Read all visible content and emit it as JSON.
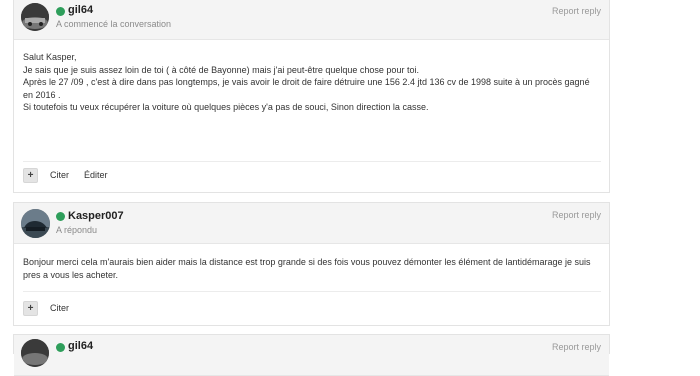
{
  "posts": [
    {
      "username": "gil64",
      "subtitle": "A commencé la conversation",
      "report_label": "Report reply",
      "lines": [
        "Salut Kasper,",
        "Je sais que je suis assez loin de toi ( à côté de Bayonne) mais j'ai peut-être quelque chose pour toi.",
        "Après le 27 /09 , c'est à dire dans pas longtemps, je vais avoir le droit de faire détruire une 156 2.4 jtd 136 cv de 1998 suite à un procès gagné en 2016 .",
        "Si toutefois tu veux récupérer la voiture où quelques pièces y'a pas de souci, Sinon direction la casse."
      ],
      "actions": {
        "plus": "+",
        "cite": "Citer",
        "edit": "Éditer"
      }
    },
    {
      "username": "Kasper007",
      "subtitle": "A répondu",
      "report_label": "Report reply",
      "lines": [
        "Bonjour merci cela m'aurais bien aider mais la distance est trop grande si des fois vous pouvez démonter les élément de lantidémarage je suis pres a vous les acheter."
      ],
      "actions": {
        "plus": "+",
        "cite": "Citer"
      }
    },
    {
      "username": "gil64",
      "report_label": "Report reply"
    }
  ],
  "colors": {
    "online": "#2e9e5b",
    "header_bg": "#f4f4f4"
  }
}
